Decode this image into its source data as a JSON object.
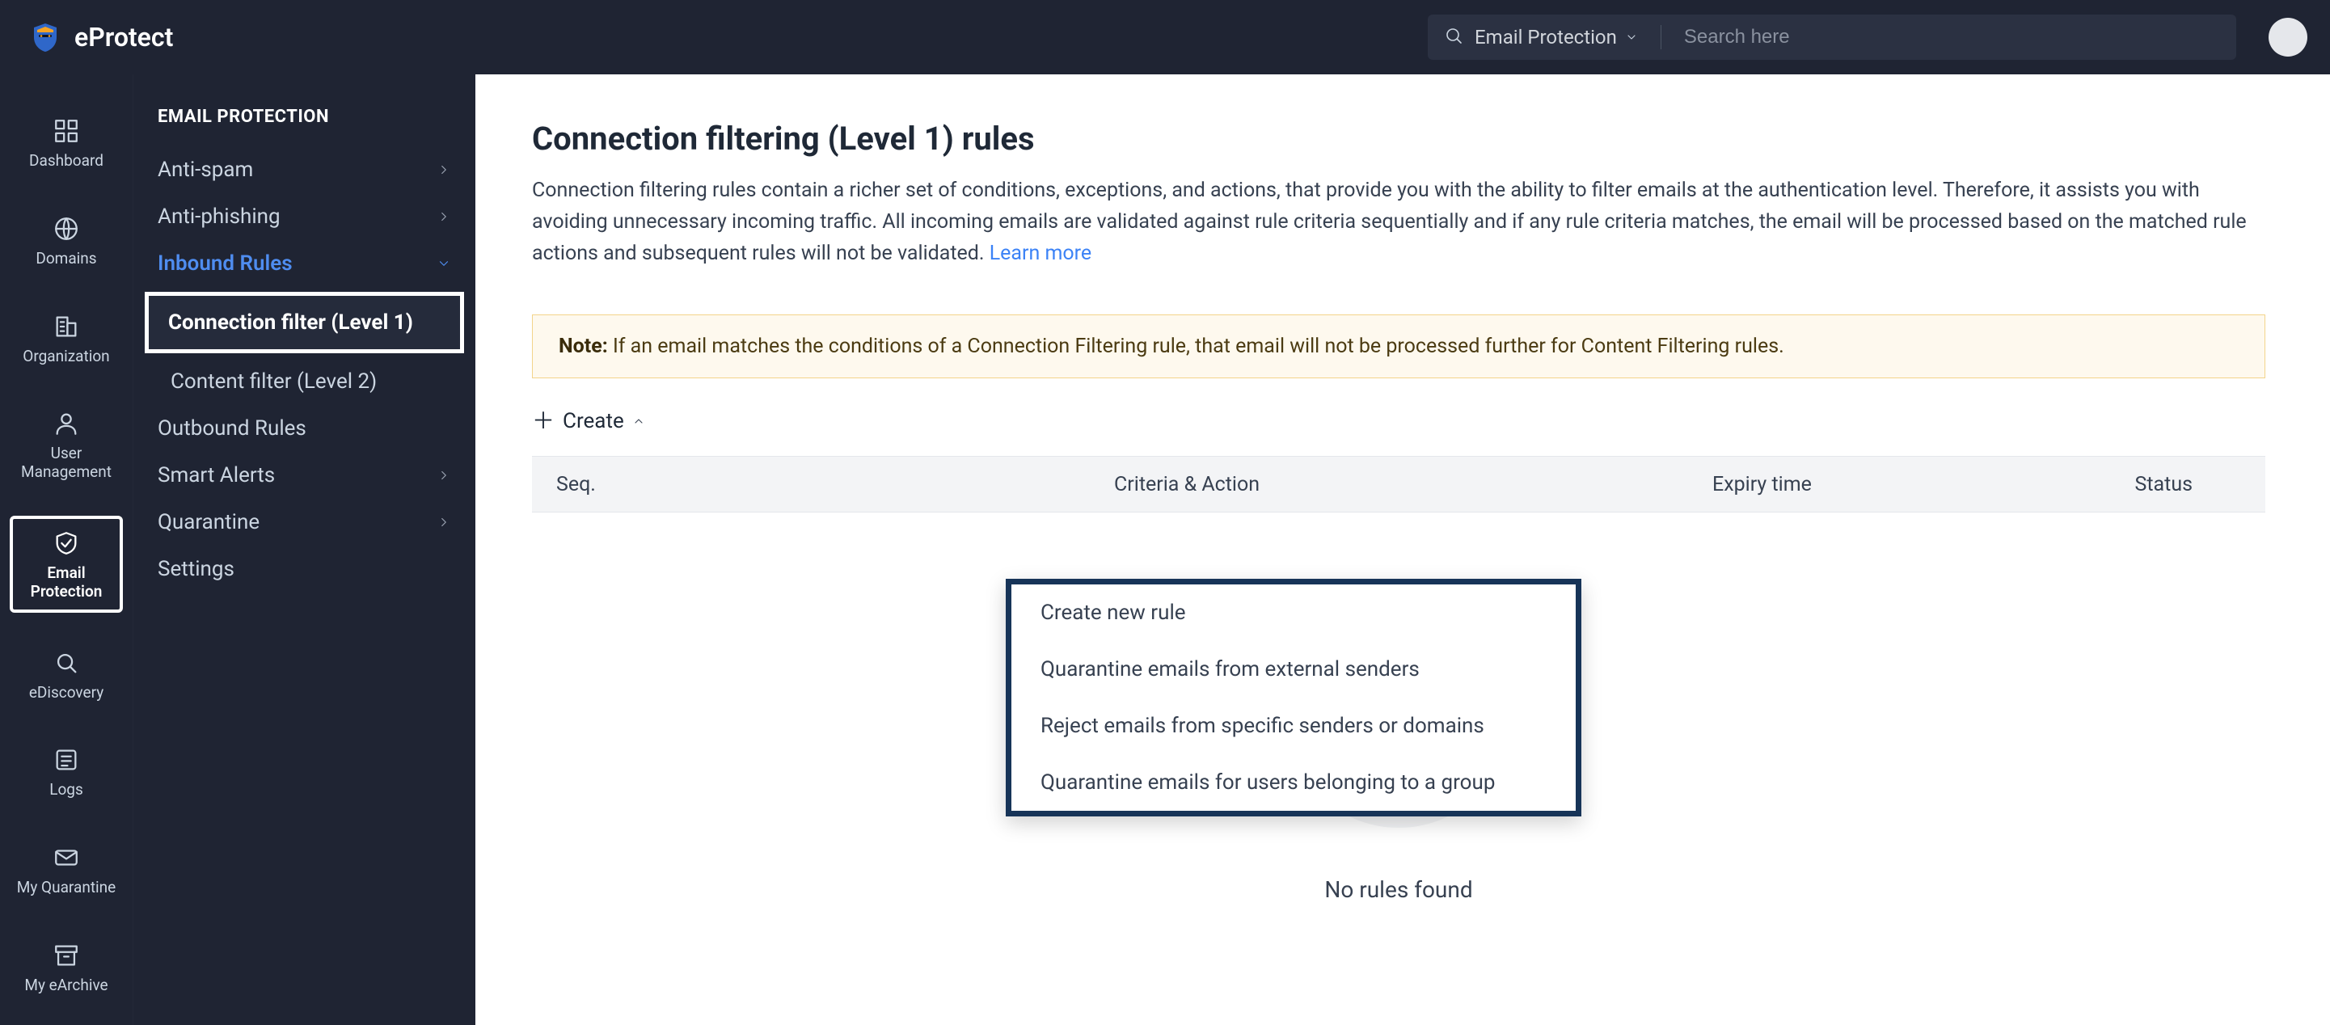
{
  "brand": {
    "name": "eProtect"
  },
  "topbar": {
    "search_scope": "Email Protection",
    "search_placeholder": "Search here"
  },
  "rail": {
    "items": [
      {
        "id": "dashboard",
        "label": "Dashboard"
      },
      {
        "id": "domains",
        "label": "Domains"
      },
      {
        "id": "organization",
        "label": "Organization"
      },
      {
        "id": "user-management",
        "label": "User Management"
      },
      {
        "id": "email-protection",
        "label": "Email Protection",
        "active": true
      },
      {
        "id": "ediscovery",
        "label": "eDiscovery"
      },
      {
        "id": "logs",
        "label": "Logs"
      },
      {
        "id": "my-quarantine",
        "label": "My Quarantine"
      },
      {
        "id": "my-earchive",
        "label": "My eArchive"
      }
    ]
  },
  "secnav": {
    "title": "EMAIL PROTECTION",
    "items": [
      {
        "label": "Anti-spam",
        "has_children": true
      },
      {
        "label": "Anti-phishing",
        "has_children": true
      },
      {
        "label": "Inbound Rules",
        "has_children": true,
        "expanded": true,
        "children": [
          {
            "label": "Connection filter (Level 1)",
            "selected": true
          },
          {
            "label": "Content filter (Level 2)"
          }
        ]
      },
      {
        "label": "Outbound Rules"
      },
      {
        "label": "Smart Alerts",
        "has_children": true
      },
      {
        "label": "Quarantine",
        "has_children": true
      },
      {
        "label": "Settings"
      }
    ]
  },
  "page": {
    "title": "Connection filtering (Level 1) rules",
    "description": "Connection filtering rules contain a richer set of conditions, exceptions, and actions, that provide you with the ability to filter emails at the authentication level. Therefore, it assists you with avoiding unnecessary incoming traffic. All incoming emails are validated against rule criteria sequentially and if any rule criteria matches, the email will be processed based on the matched rule actions and subsequent rules will not be validated.",
    "learn_more": "Learn more",
    "note_label": "Note:",
    "note_text": "If an email matches the conditions of a Connection Filtering rule, that email will not be processed further for Content Filtering rules.",
    "create_label": "Create",
    "columns": {
      "seq": "Seq.",
      "criteria": "Criteria & Action",
      "expiry": "Expiry time",
      "status": "Status"
    },
    "empty_text": "No rules found"
  },
  "create_menu": {
    "items": [
      "Create new rule",
      "Quarantine emails from external senders",
      "Reject emails from specific senders or domains",
      "Quarantine emails for users belonging to a group"
    ]
  }
}
